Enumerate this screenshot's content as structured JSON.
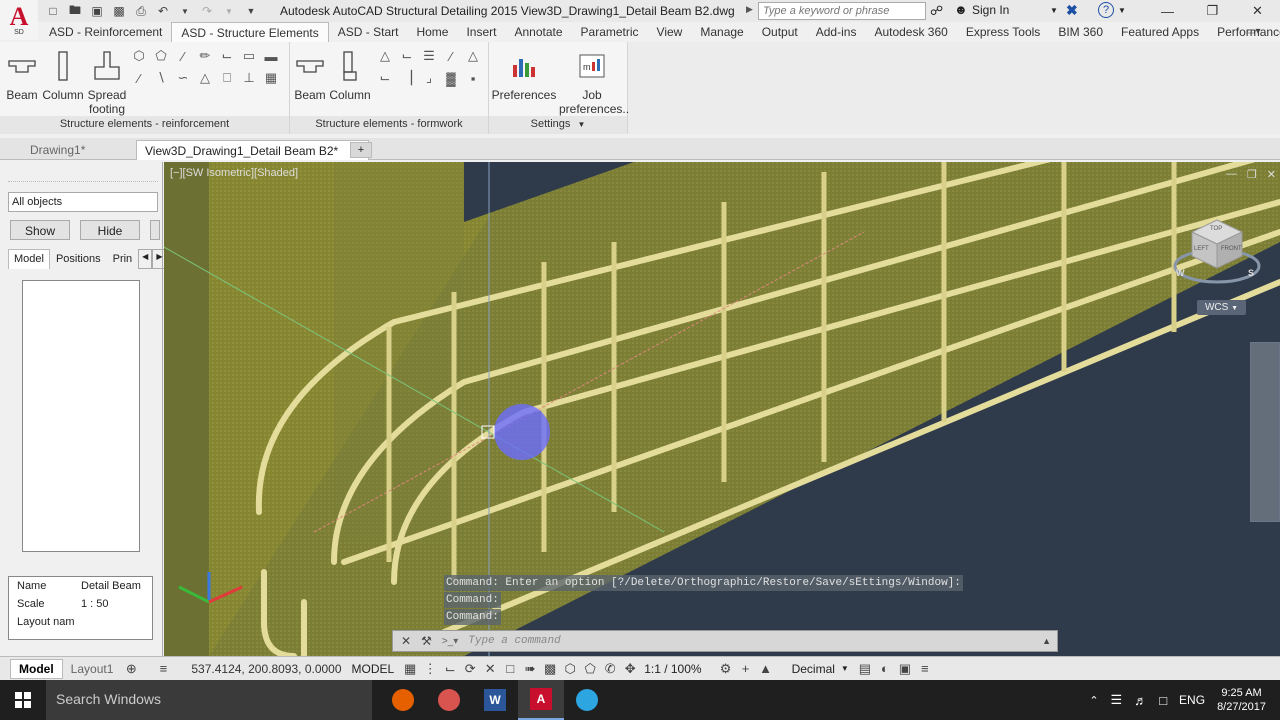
{
  "app": {
    "logo_letter": "A",
    "logo_sub": "SD",
    "title": "Autodesk AutoCAD Structural Detailing 2015    View3D_Drawing1_Detail Beam B2.dwg",
    "search_placeholder": "Type a keyword or phrase",
    "sign_in": "Sign In"
  },
  "ribbon_tabs": [
    "ASD - Reinforcement",
    "ASD - Structure Elements",
    "ASD - Start",
    "Home",
    "Insert",
    "Annotate",
    "Parametric",
    "View",
    "Manage",
    "Output",
    "Add-ins",
    "Autodesk 360",
    "Express Tools",
    "BIM 360",
    "Featured Apps",
    "Performance"
  ],
  "ribbon_active_tab": "ASD - Structure Elements",
  "panels": {
    "reinforcement": {
      "title": "Structure elements - reinforcement",
      "buttons": [
        "Beam",
        "Column",
        "Spread footing"
      ]
    },
    "formwork": {
      "title": "Structure elements - formwork",
      "buttons": [
        "Beam",
        "Column"
      ]
    },
    "settings": {
      "title": "Settings",
      "buttons": [
        "Preferences",
        "Job preferences..."
      ]
    }
  },
  "file_tabs": [
    "Drawing1*",
    "View3D_Drawing1_Detail Beam B2*"
  ],
  "left_panel": {
    "filter": "All objects",
    "show": "Show",
    "hide": "Hide",
    "tabs": [
      "Model",
      "Positions",
      "Prin"
    ],
    "props": [
      {
        "k": "Name",
        "v": "Detail Beam"
      },
      {
        "k": "Scale",
        "v": "1 : 50"
      },
      {
        "k": "Layout nam",
        "v": ""
      }
    ]
  },
  "viewport": {
    "label": "[−][SW Isometric][Shaded]",
    "wcs": "WCS",
    "viewcube_faces": [
      "TOP",
      "LEFT",
      "FRONT"
    ],
    "compass": [
      "W",
      "S"
    ]
  },
  "command": {
    "history": [
      "Command:  Enter an option [?/Delete/Orthographic/Restore/Save/sEttings/Window]:",
      "Command:",
      "Command:"
    ],
    "placeholder": "Type a command"
  },
  "status": {
    "model_tab": "Model",
    "layout_tab": "Layout1",
    "coords": "537.4124, 200.8093, 0.0000",
    "space": "MODEL",
    "scale": "1:1 / 100%",
    "units": "Decimal"
  },
  "taskbar": {
    "search": "Search Windows",
    "lang": "ENG",
    "time": "9:25 AM",
    "date": "8/27/2017"
  }
}
